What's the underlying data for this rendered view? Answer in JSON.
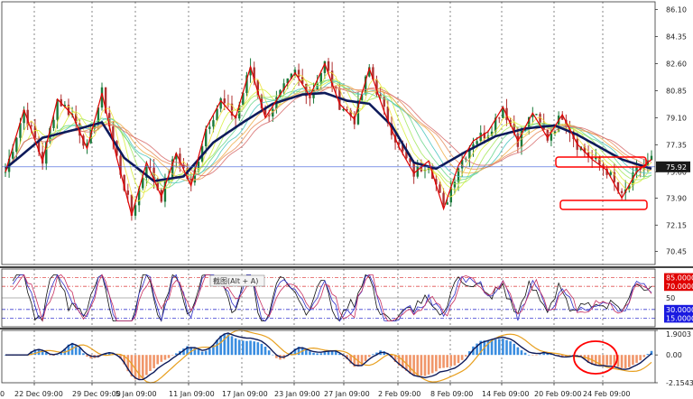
{
  "main_panel": {
    "price_ticks": [
      "86.10",
      "84.35",
      "82.60",
      "80.85",
      "79.10",
      "77.35",
      "75.60",
      "73.90",
      "72.15",
      "70.45"
    ],
    "current_price": "75.92"
  },
  "oscillator_panel": {
    "tooltip": "截图(Alt + A)",
    "levels": [
      {
        "label": "85.0000",
        "value": 85,
        "style": "red"
      },
      {
        "label": "70.0000",
        "value": 70,
        "style": "red"
      },
      {
        "label": "50",
        "value": 50,
        "style": "plain"
      },
      {
        "label": "30.0000",
        "value": 30,
        "style": "blue"
      },
      {
        "label": "15.0000",
        "value": 15,
        "style": "blue"
      }
    ]
  },
  "macd_panel": {
    "ticks": [
      "1.9003",
      "0.00",
      "-2.1543"
    ]
  },
  "time_axis": {
    "labels": [
      "22 Dec 09:00",
      "29 Dec 09:00",
      "5 Jan 09:00",
      "11 Jan 09:00",
      "17 Jan 09:00",
      "23 Jan 09:00",
      "27 Jan 09:00",
      "2 Feb 09:00",
      "8 Feb 09:00",
      "14 Feb 09:00",
      "20 Feb 09:00",
      "24 Feb 09:00"
    ],
    "left_fragment": "0"
  },
  "colors": {
    "zigzag": "#e00000",
    "slow_ma": "#0d1a5a",
    "current_price_bg": "#1a1a1a",
    "level_red_bg": "#e00000",
    "level_blue_bg": "#1a1ae0",
    "macd_pos": "#3a8de0",
    "macd_neg": "#f0966a",
    "signal": "#e8a020",
    "highlight": "#ff0000"
  },
  "chart_data": {
    "type": "candlestick",
    "zigzag_points": [
      [
        0,
        75.6
      ],
      [
        5,
        79.6
      ],
      [
        10,
        76.3
      ],
      [
        14,
        80.3
      ],
      [
        18,
        79.3
      ],
      [
        22,
        77.1
      ],
      [
        26,
        80.7
      ],
      [
        30,
        76.5
      ],
      [
        34,
        72.8
      ],
      [
        38,
        76.2
      ],
      [
        42,
        74.0
      ],
      [
        46,
        76.8
      ],
      [
        50,
        74.7
      ],
      [
        54,
        78.4
      ],
      [
        58,
        80.2
      ],
      [
        62,
        79.1
      ],
      [
        66,
        82.4
      ],
      [
        70,
        79.1
      ],
      [
        74,
        80.6
      ],
      [
        78,
        82.0
      ],
      [
        82,
        80.5
      ],
      [
        86,
        82.6
      ],
      [
        90,
        80.0
      ],
      [
        94,
        79.0
      ],
      [
        98,
        82.3
      ],
      [
        102,
        79.5
      ],
      [
        106,
        77.2
      ],
      [
        110,
        75.5
      ],
      [
        114,
        76.3
      ],
      [
        118,
        73.2
      ],
      [
        122,
        76.0
      ],
      [
        126,
        77.6
      ],
      [
        130,
        78.2
      ],
      [
        134,
        79.8
      ],
      [
        138,
        77.6
      ],
      [
        142,
        79.4
      ],
      [
        146,
        77.8
      ],
      [
        150,
        79.3
      ],
      [
        154,
        77.4
      ],
      [
        158,
        76.4
      ],
      [
        162,
        75.7
      ],
      [
        166,
        73.9
      ],
      [
        170,
        75.6
      ],
      [
        174,
        76.4
      ]
    ],
    "slow_ma": [
      [
        0,
        75.8
      ],
      [
        10,
        77.8
      ],
      [
        20,
        78.4
      ],
      [
        26,
        78.8
      ],
      [
        32,
        76.5
      ],
      [
        40,
        75.0
      ],
      [
        48,
        75.3
      ],
      [
        56,
        77.5
      ],
      [
        64,
        78.8
      ],
      [
        72,
        80.0
      ],
      [
        80,
        80.6
      ],
      [
        86,
        80.7
      ],
      [
        92,
        80.2
      ],
      [
        98,
        80.0
      ],
      [
        104,
        78.6
      ],
      [
        110,
        76.2
      ],
      [
        116,
        75.8
      ],
      [
        124,
        76.9
      ],
      [
        132,
        77.9
      ],
      [
        140,
        78.4
      ],
      [
        148,
        78.6
      ],
      [
        154,
        78.0
      ],
      [
        160,
        77.2
      ],
      [
        166,
        76.4
      ],
      [
        174,
        75.8
      ]
    ],
    "oscillator_range": [
      0,
      100
    ],
    "macd_range": [
      -2.1543,
      1.9003
    ]
  }
}
